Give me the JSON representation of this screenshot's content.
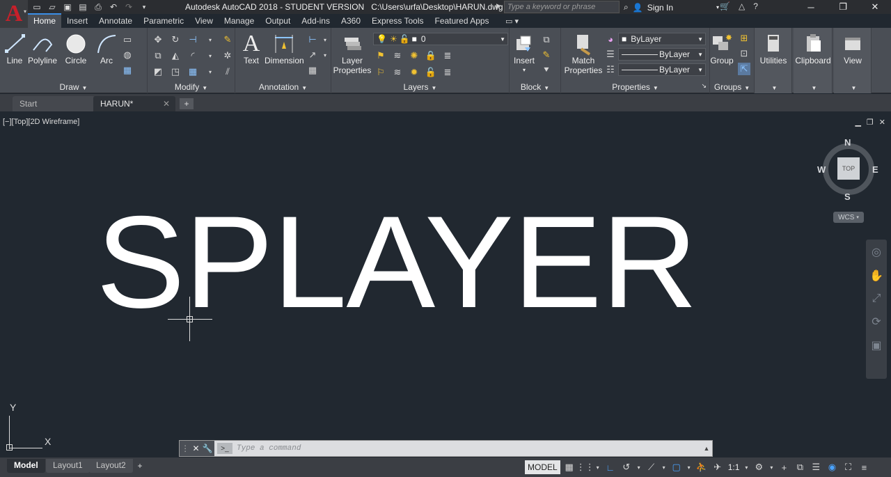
{
  "title_bar": {
    "app_name": "Autodesk AutoCAD 2018 - STUDENT VERSION",
    "file_path": "C:\\Users\\urfa\\Desktop\\HARUN.dwg",
    "search_placeholder": "Type a keyword or phrase",
    "signin_label": "Sign In"
  },
  "ribbon_tabs": [
    "Home",
    "Insert",
    "Annotate",
    "Parametric",
    "View",
    "Manage",
    "Output",
    "Add-ins",
    "A360",
    "Express Tools",
    "Featured Apps"
  ],
  "panels": {
    "draw": {
      "title": "Draw",
      "tools": [
        "Line",
        "Polyline",
        "Circle",
        "Arc"
      ]
    },
    "modify": {
      "title": "Modify"
    },
    "annotation": {
      "title": "Annotation",
      "tools": [
        "Text",
        "Dimension"
      ]
    },
    "layers": {
      "title": "Layers",
      "layer_properties": "Layer\nProperties",
      "current_layer": "0"
    },
    "block": {
      "title": "Block",
      "insert": "Insert"
    },
    "properties": {
      "title": "Properties",
      "match": "Match\nProperties",
      "color": "ByLayer",
      "linetype": "ByLayer",
      "lineweight": "ByLayer"
    },
    "groups": {
      "title": "Groups",
      "group": "Group"
    },
    "utilities": "Utilities",
    "clipboard": "Clipboard",
    "view": "View"
  },
  "file_tabs": [
    "Start",
    "HARUN*"
  ],
  "viewport": {
    "label": "[−][Top][2D Wireframe]",
    "drawing_text": "SPLAYER",
    "viewcube": {
      "north": "N",
      "south": "S",
      "east": "E",
      "west": "W",
      "face": "TOP"
    },
    "wcs": "WCS",
    "ucs_x": "X",
    "ucs_y": "Y"
  },
  "command_line": {
    "placeholder": "Type a command"
  },
  "layout_tabs": [
    "Model",
    "Layout1",
    "Layout2"
  ],
  "status_bar": {
    "model": "MODEL",
    "scale": "1:1"
  },
  "colors": {
    "canvas": "#212830",
    "ribbon": "#4a4e55",
    "accent": "#3a8ee6",
    "logo_red": "#c8202a"
  }
}
